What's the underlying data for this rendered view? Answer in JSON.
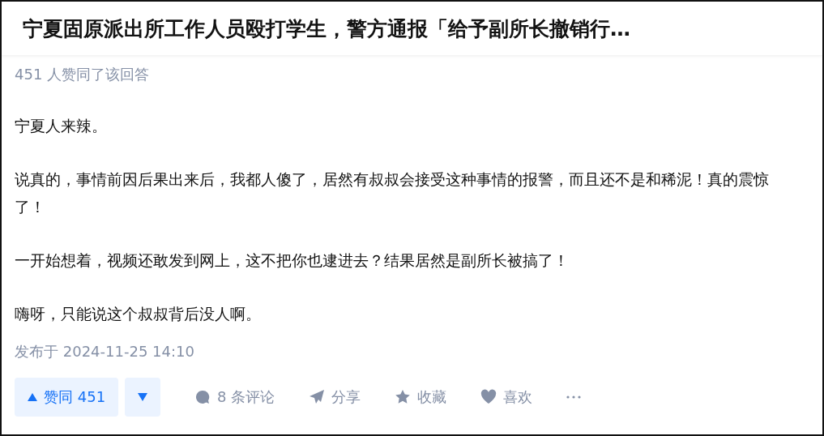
{
  "title": "宁夏固原派出所工作人员殴打学生，警方通报「给予副所长撤销行…",
  "endorsement": "451 人赞同了该回答",
  "paragraphs": [
    "宁夏人来辣。",
    "说真的，事情前因后果出来后，我都人傻了，居然有叔叔会接受这种事情的报警，而且还不是和稀泥！真的震惊了！",
    "一开始想着，视频还敢发到网上，这不把你也逮进去？结果居然是副所长被搞了！",
    "嗨呀，只能说这个叔叔背后没人啊。"
  ],
  "published": "发布于 2024-11-25 14:10",
  "vote": {
    "label": "赞同 451"
  },
  "actions": [
    {
      "kind": "comment",
      "label": "8 条评论"
    },
    {
      "kind": "share",
      "label": "分享"
    },
    {
      "kind": "collect",
      "label": "收藏"
    },
    {
      "kind": "like",
      "label": "喜欢"
    },
    {
      "kind": "more"
    }
  ]
}
